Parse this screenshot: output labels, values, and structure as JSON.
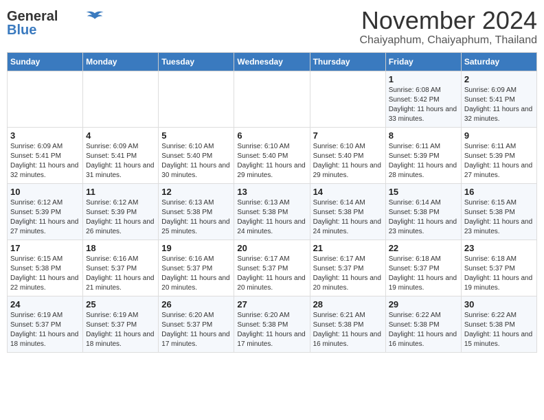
{
  "header": {
    "logo_line1": "General",
    "logo_line2": "Blue",
    "month": "November 2024",
    "location": "Chaiyaphum, Chaiyaphum, Thailand"
  },
  "weekdays": [
    "Sunday",
    "Monday",
    "Tuesday",
    "Wednesday",
    "Thursday",
    "Friday",
    "Saturday"
  ],
  "weeks": [
    [
      {
        "day": "",
        "info": ""
      },
      {
        "day": "",
        "info": ""
      },
      {
        "day": "",
        "info": ""
      },
      {
        "day": "",
        "info": ""
      },
      {
        "day": "",
        "info": ""
      },
      {
        "day": "1",
        "info": "Sunrise: 6:08 AM\nSunset: 5:42 PM\nDaylight: 11 hours and 33 minutes."
      },
      {
        "day": "2",
        "info": "Sunrise: 6:09 AM\nSunset: 5:41 PM\nDaylight: 11 hours and 32 minutes."
      }
    ],
    [
      {
        "day": "3",
        "info": "Sunrise: 6:09 AM\nSunset: 5:41 PM\nDaylight: 11 hours and 32 minutes."
      },
      {
        "day": "4",
        "info": "Sunrise: 6:09 AM\nSunset: 5:41 PM\nDaylight: 11 hours and 31 minutes."
      },
      {
        "day": "5",
        "info": "Sunrise: 6:10 AM\nSunset: 5:40 PM\nDaylight: 11 hours and 30 minutes."
      },
      {
        "day": "6",
        "info": "Sunrise: 6:10 AM\nSunset: 5:40 PM\nDaylight: 11 hours and 29 minutes."
      },
      {
        "day": "7",
        "info": "Sunrise: 6:10 AM\nSunset: 5:40 PM\nDaylight: 11 hours and 29 minutes."
      },
      {
        "day": "8",
        "info": "Sunrise: 6:11 AM\nSunset: 5:39 PM\nDaylight: 11 hours and 28 minutes."
      },
      {
        "day": "9",
        "info": "Sunrise: 6:11 AM\nSunset: 5:39 PM\nDaylight: 11 hours and 27 minutes."
      }
    ],
    [
      {
        "day": "10",
        "info": "Sunrise: 6:12 AM\nSunset: 5:39 PM\nDaylight: 11 hours and 27 minutes."
      },
      {
        "day": "11",
        "info": "Sunrise: 6:12 AM\nSunset: 5:39 PM\nDaylight: 11 hours and 26 minutes."
      },
      {
        "day": "12",
        "info": "Sunrise: 6:13 AM\nSunset: 5:38 PM\nDaylight: 11 hours and 25 minutes."
      },
      {
        "day": "13",
        "info": "Sunrise: 6:13 AM\nSunset: 5:38 PM\nDaylight: 11 hours and 24 minutes."
      },
      {
        "day": "14",
        "info": "Sunrise: 6:14 AM\nSunset: 5:38 PM\nDaylight: 11 hours and 24 minutes."
      },
      {
        "day": "15",
        "info": "Sunrise: 6:14 AM\nSunset: 5:38 PM\nDaylight: 11 hours and 23 minutes."
      },
      {
        "day": "16",
        "info": "Sunrise: 6:15 AM\nSunset: 5:38 PM\nDaylight: 11 hours and 23 minutes."
      }
    ],
    [
      {
        "day": "17",
        "info": "Sunrise: 6:15 AM\nSunset: 5:38 PM\nDaylight: 11 hours and 22 minutes."
      },
      {
        "day": "18",
        "info": "Sunrise: 6:16 AM\nSunset: 5:37 PM\nDaylight: 11 hours and 21 minutes."
      },
      {
        "day": "19",
        "info": "Sunrise: 6:16 AM\nSunset: 5:37 PM\nDaylight: 11 hours and 20 minutes."
      },
      {
        "day": "20",
        "info": "Sunrise: 6:17 AM\nSunset: 5:37 PM\nDaylight: 11 hours and 20 minutes."
      },
      {
        "day": "21",
        "info": "Sunrise: 6:17 AM\nSunset: 5:37 PM\nDaylight: 11 hours and 20 minutes."
      },
      {
        "day": "22",
        "info": "Sunrise: 6:18 AM\nSunset: 5:37 PM\nDaylight: 11 hours and 19 minutes."
      },
      {
        "day": "23",
        "info": "Sunrise: 6:18 AM\nSunset: 5:37 PM\nDaylight: 11 hours and 19 minutes."
      }
    ],
    [
      {
        "day": "24",
        "info": "Sunrise: 6:19 AM\nSunset: 5:37 PM\nDaylight: 11 hours and 18 minutes."
      },
      {
        "day": "25",
        "info": "Sunrise: 6:19 AM\nSunset: 5:37 PM\nDaylight: 11 hours and 18 minutes."
      },
      {
        "day": "26",
        "info": "Sunrise: 6:20 AM\nSunset: 5:37 PM\nDaylight: 11 hours and 17 minutes."
      },
      {
        "day": "27",
        "info": "Sunrise: 6:20 AM\nSunset: 5:38 PM\nDaylight: 11 hours and 17 minutes."
      },
      {
        "day": "28",
        "info": "Sunrise: 6:21 AM\nSunset: 5:38 PM\nDaylight: 11 hours and 16 minutes."
      },
      {
        "day": "29",
        "info": "Sunrise: 6:22 AM\nSunset: 5:38 PM\nDaylight: 11 hours and 16 minutes."
      },
      {
        "day": "30",
        "info": "Sunrise: 6:22 AM\nSunset: 5:38 PM\nDaylight: 11 hours and 15 minutes."
      }
    ]
  ]
}
